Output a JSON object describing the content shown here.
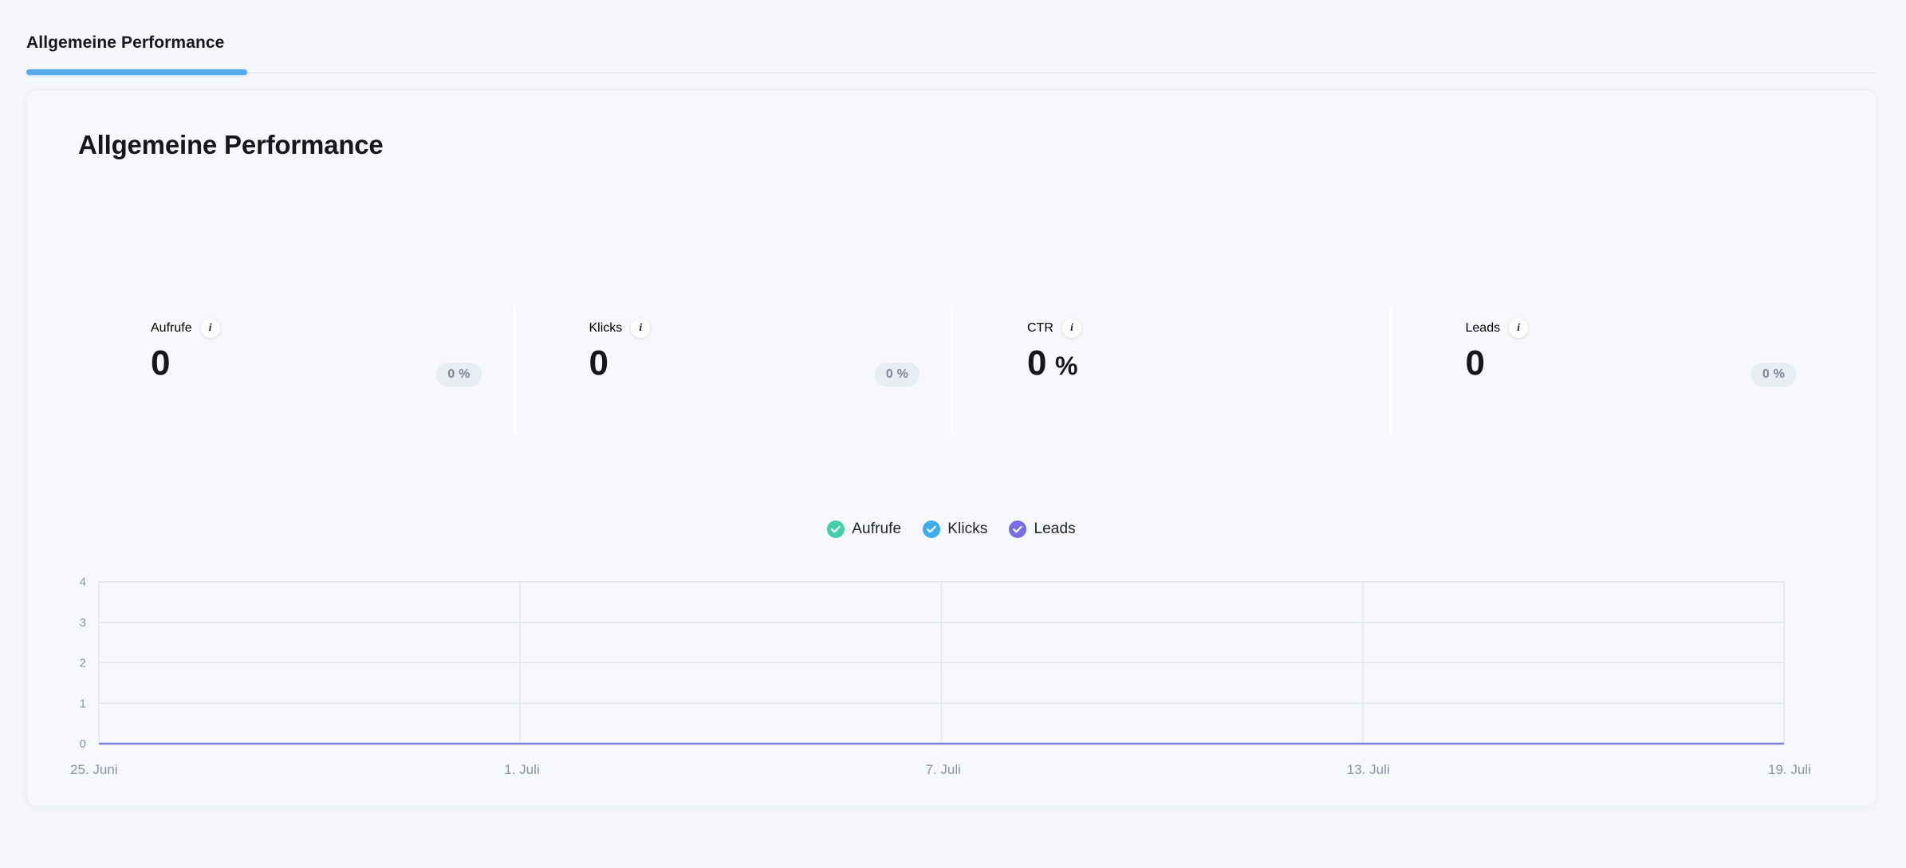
{
  "tabbar": {
    "active_tab": "Allgemeine Performance"
  },
  "card": {
    "title": "Allgemeine Performance",
    "kpis": [
      {
        "label": "Aufrufe",
        "value": "0",
        "unit": "",
        "delta": "0 %",
        "info_icon": "info-icon"
      },
      {
        "label": "Klicks",
        "value": "0",
        "unit": "",
        "delta": "0 %",
        "info_icon": "info-icon"
      },
      {
        "label": "CTR",
        "value": "0",
        "unit": "%",
        "delta": "",
        "info_icon": "info-icon"
      },
      {
        "label": "Leads",
        "value": "0",
        "unit": "",
        "delta": "0 %",
        "info_icon": "info-icon"
      }
    ],
    "legend": [
      {
        "label": "Aufrufe",
        "color": "#44cdad",
        "checked": true,
        "icon": "check-icon"
      },
      {
        "label": "Klicks",
        "color": "#3dacf0",
        "checked": true,
        "icon": "check-icon"
      },
      {
        "label": "Leads",
        "color": "#7a6ce8",
        "checked": true,
        "icon": "check-icon"
      }
    ]
  },
  "chart_data": {
    "type": "line",
    "title": "Allgemeine Performance",
    "xlabel": "",
    "ylabel": "",
    "grid": true,
    "legend_position": "top-center",
    "ylim": [
      0,
      4
    ],
    "yticks": [
      "0",
      "1",
      "2",
      "3",
      "4"
    ],
    "x": [
      "25. Juni",
      "1. Juli",
      "7. Juli",
      "13. Juli",
      "19. Juli"
    ],
    "xticks": [
      "25. Juni",
      "1. Juli",
      "7. Juli",
      "13. Juli",
      "19. Juli"
    ],
    "series": [
      {
        "name": "Aufrufe",
        "color": "#44cdad",
        "values": [
          0,
          0,
          0,
          0,
          0
        ]
      },
      {
        "name": "Klicks",
        "color": "#3dacf0",
        "values": [
          0,
          0,
          0,
          0,
          0
        ]
      },
      {
        "name": "Leads",
        "color": "#7a6ce8",
        "values": [
          0,
          0,
          0,
          0,
          0
        ]
      }
    ],
    "baseline_color": "#7c7fd8",
    "grid_color": "#e3e6ec"
  }
}
